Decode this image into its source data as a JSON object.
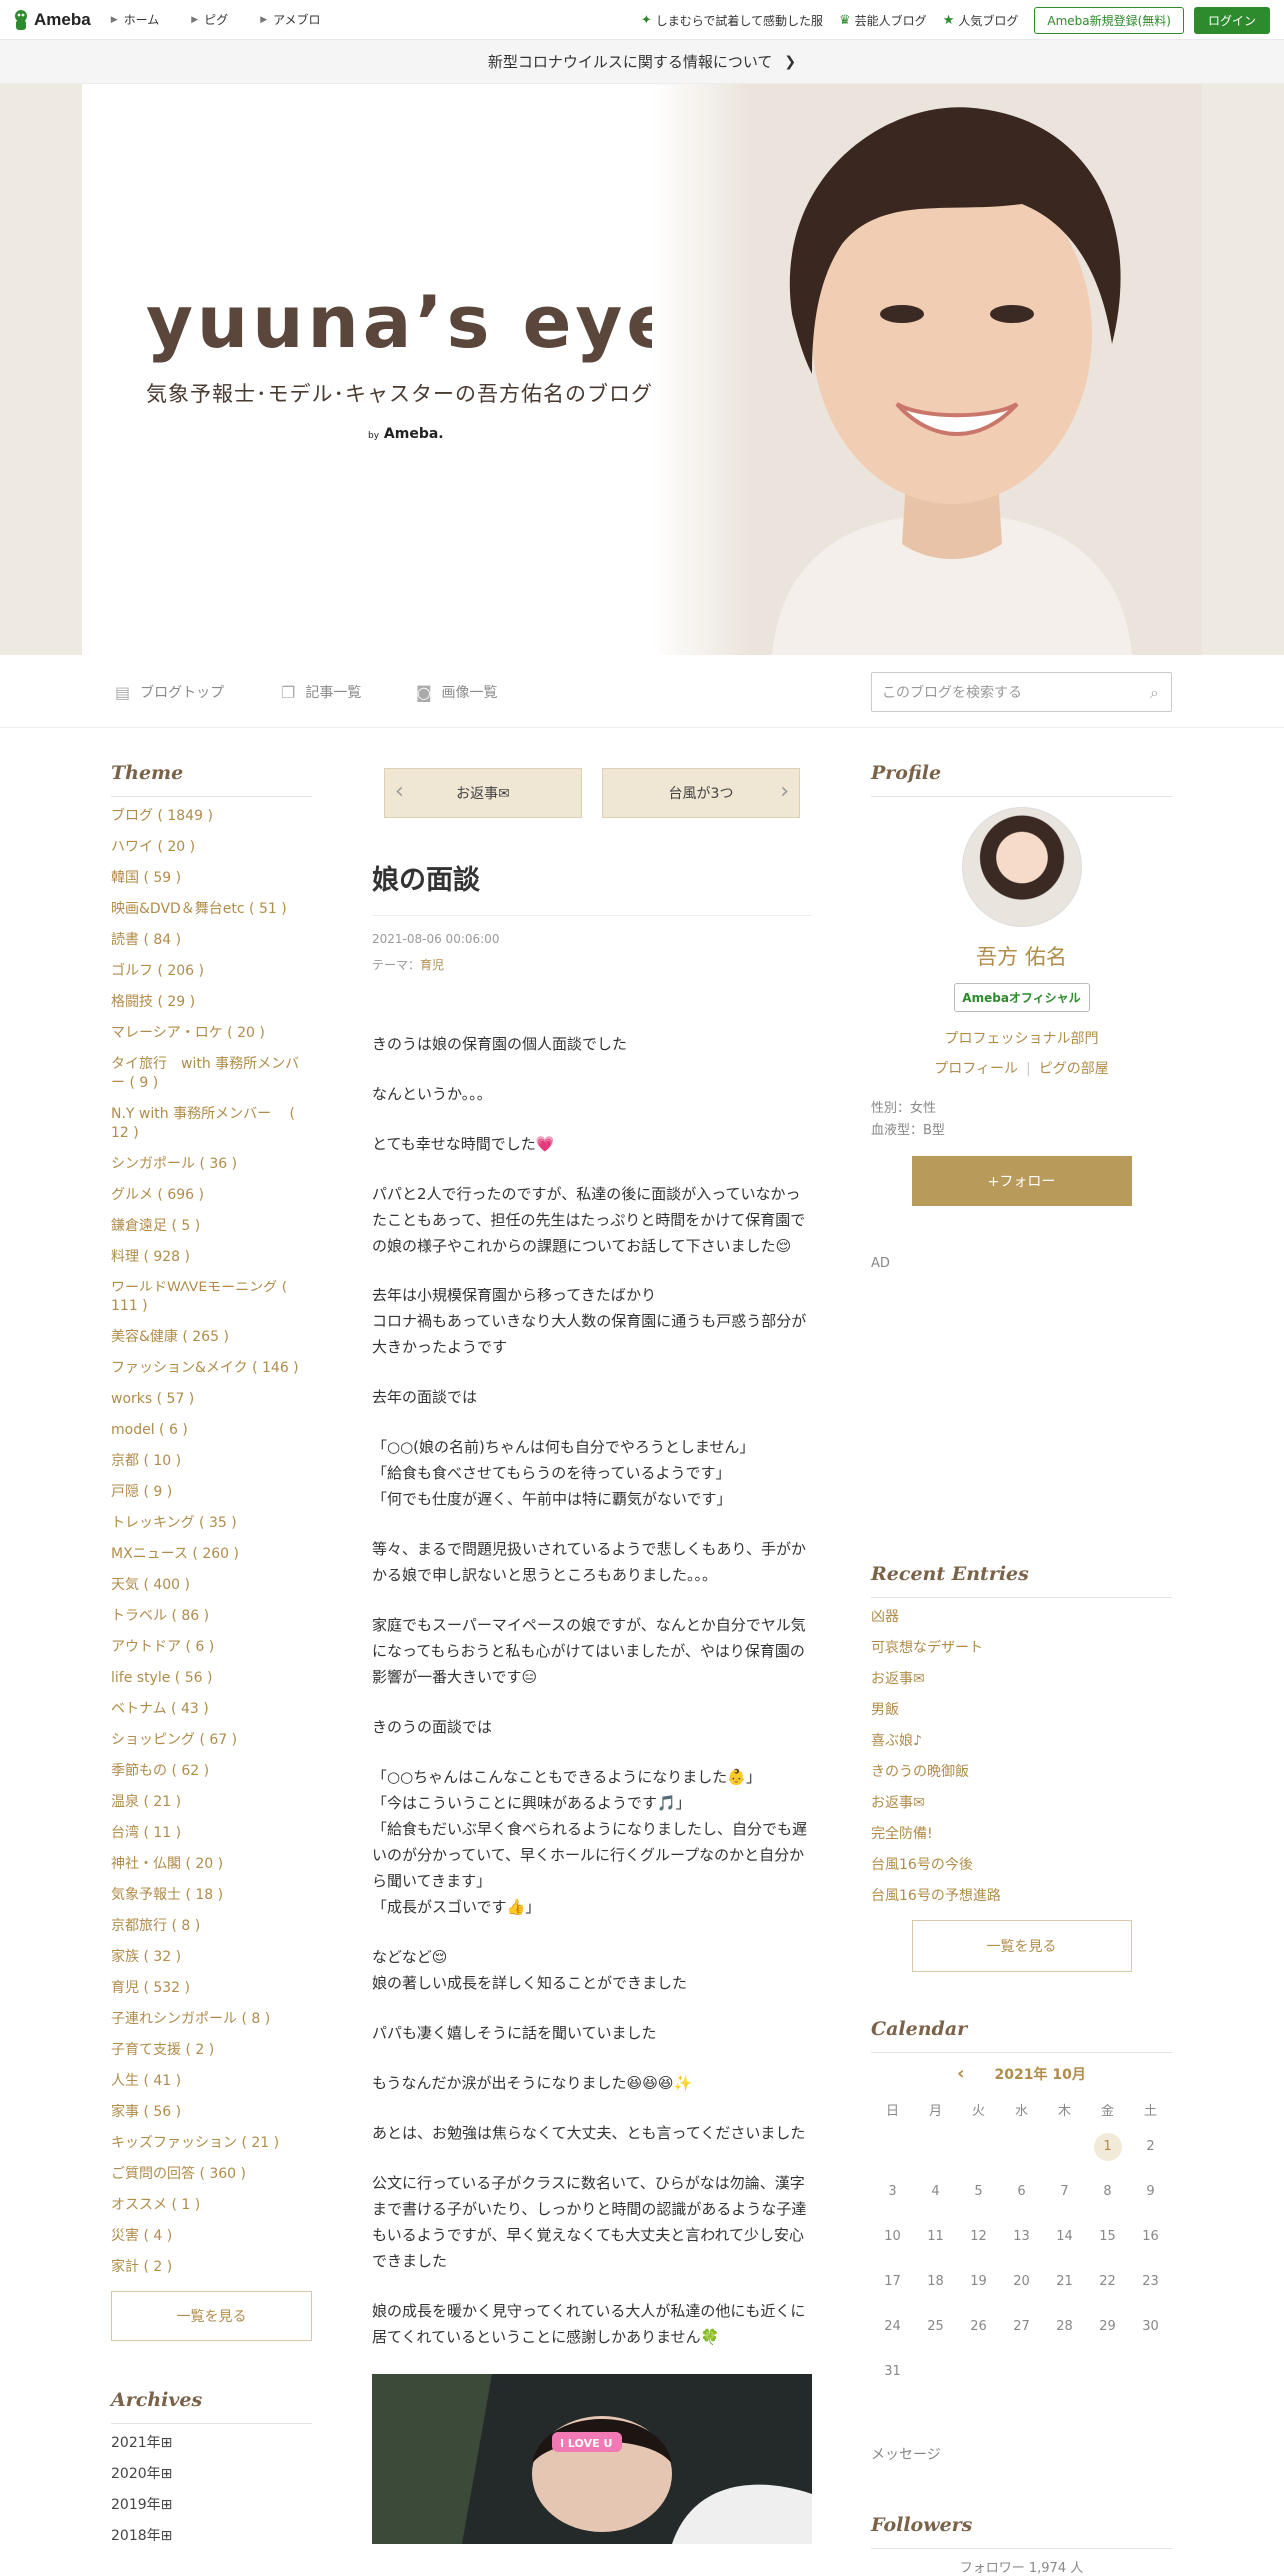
{
  "topbar": {
    "logo": "Ameba",
    "nav": [
      "ホーム",
      "ピグ",
      "アメブロ"
    ],
    "right_links": [
      {
        "label": "しまむらで試着して感動した服",
        "icon": "sparkle-icon"
      },
      {
        "label": "芸能人ブログ",
        "icon": "crown-icon"
      },
      {
        "label": "人気ブログ",
        "icon": "star-icon"
      }
    ],
    "register": "Ameba新規登録(無料)",
    "login": "ログイン"
  },
  "notice": "新型コロナウイルスに関する情報について",
  "hero": {
    "title": "yuuna’s eye",
    "subtitle": "気象予報士･モデル･キャスターの吾方佑名のブログ",
    "by": "by",
    "by_brand": "Ameba."
  },
  "blognav": {
    "top": "ブログトップ",
    "entries": "記事一覧",
    "images": "画像一覧",
    "search_placeholder": "このブログを検索する"
  },
  "theme": {
    "heading": "Theme",
    "items": [
      "ブログ ( 1849 )",
      "ハワイ ( 20 )",
      "韓国 ( 59 )",
      "映画&DVD＆舞台etc ( 51 )",
      "読書 ( 84 )",
      "ゴルフ ( 206 )",
      "格闘技 ( 29 )",
      "マレーシア・ロケ ( 20 )",
      "タイ旅行　with 事務所メンバー ( 9 )",
      "N.Y with 事務所メンバー　 ( 12 )",
      "シンガポール ( 36 )",
      "グルメ ( 696 )",
      "鎌倉遠足 ( 5 )",
      "料理 ( 928 )",
      "ワールドWAVEモーニング ( 111 )",
      "美容&健康 ( 265 )",
      "ファッション&メイク ( 146 )",
      "works ( 57 )",
      "model ( 6 )",
      "京都 ( 10 )",
      "戸隠 ( 9 )",
      "トレッキング ( 35 )",
      "MXニュース ( 260 )",
      "天気 ( 400 )",
      "トラベル ( 86 )",
      "アウトドア ( 6 )",
      "life style ( 56 )",
      "ベトナム ( 43 )",
      "ショッピング ( 67 )",
      "季節もの ( 62 )",
      "温泉 ( 21 )",
      "台湾 ( 11 )",
      "神社・仏閣 ( 20 )",
      "気象予報士 ( 18 )",
      "京都旅行 ( 8 )",
      "家族 ( 32 )",
      "育児 ( 532 )",
      "子連れシンガポール ( 8 )",
      "子育て支援 ( 2 )",
      "人生 ( 41 )",
      "家事 ( 56 )",
      "キッズファッション ( 21 )",
      "ご質問の回答 ( 360 )",
      "オススメ ( 1 )",
      "災害 ( 4 )",
      "家計 ( 2 )"
    ],
    "more": "一覧を見る"
  },
  "archives": {
    "heading": "Archives",
    "items": [
      "2021年⊞",
      "2020年⊞",
      "2019年⊞",
      "2018年⊞"
    ]
  },
  "entry": {
    "prev": "お返事✉",
    "next": "台風が3つ",
    "title": "娘の面談",
    "date": "2021-08-06 00:06:00",
    "theme_label": "テーマ：",
    "theme": "育児",
    "paragraphs": [
      "きのうは娘の保育園の個人面談でした",
      "なんというか。。。",
      "とても幸せな時間でした💗",
      "パパと2人で行ったのですが、私達の後に面談が入っていなかったこともあって、担任の先生はたっぷりと時間をかけて保育園での娘の様子やこれからの課題についてお話して下さいました😌",
      "去年は小規模保育園から移ってきたばかり\nコロナ禍もあっていきなり大人数の保育園に通うも戸惑う部分が大きかったようです",
      "去年の面談では",
      "「○○(娘の名前)ちゃんは何も自分でやろうとしません」\n「給食も食べさせてもらうのを待っているようです」\n「何でも仕度が遅く、午前中は特に覇気がないです」",
      "等々、まるで問題児扱いされているようで悲しくもあり、手がかかる娘で申し訳ないと思うところもありました。。。",
      "家庭でもスーパーマイペースの娘ですが、なんとか自分でヤル気になってもらおうと私も心がけてはいましたが、やはり保育園の影響が一番大きいです😑",
      "きのうの面談では",
      "「○○ちゃんはこんなこともできるようになりました👶」\n「今はこういうことに興味があるようです🎵」\n「給食もだいぶ早く食べられるようになりましたし、自分でも遅いのが分かっていて、早くホールに行くグループなのかと自分から聞いてきます」\n「成長がスゴいです👍」",
      "などなど😌\n娘の著しい成長を詳しく知ることができました",
      "パパも凄く嬉しそうに話を聞いていました",
      "もうなんだか涙が出そうになりました😆😆😆✨",
      "あとは、お勉強は焦らなくて大丈夫、とも言ってくださいました",
      "公文に行っている子がクラスに数名いて、ひらがなは勿論、漢字まで書ける子がいたり、しっかりと時間の認識があるような子達もいるようですが、早く覚えなくても大丈夫と言われて少し安心できました",
      "娘の成長を暖かく見守ってくれている大人が私達の他にも近くに居てくれているということに感謝しかありません🍀"
    ],
    "photo_sticker": "I LOVE U"
  },
  "profile": {
    "heading": "Profile",
    "name": "吾方 佑名",
    "badge": "Amebaオフィシャル",
    "category": "プロフェッショナル部門",
    "link1": "プロフィール",
    "link2": "ピグの部屋",
    "gender": "性別：女性",
    "blood": "血液型：B型",
    "follow": "+フォロー",
    "ad": "AD"
  },
  "recent": {
    "heading": "Recent Entries",
    "items": [
      "凶器",
      "可哀想なデザート",
      "お返事✉",
      "男飯",
      "喜ぶ娘♪",
      "きのうの晩御飯",
      "お返事✉",
      "完全防備!",
      "台風16号の今後",
      "台風16号の予想進路"
    ],
    "more": "一覧を見る"
  },
  "calendar": {
    "heading": "Calendar",
    "month": "2021年 10月",
    "weekdays": [
      "日",
      "月",
      "火",
      "水",
      "木",
      "金",
      "土"
    ],
    "leading_blanks": 5,
    "days": 31,
    "today": 1
  },
  "message": "メッセージ",
  "followers": {
    "heading": "Followers",
    "count": "フォロワー 1,974 人"
  },
  "colors": {
    "accent": "#b08c4a",
    "green": "#2d8a2d",
    "brown_text": "#5a463b"
  }
}
